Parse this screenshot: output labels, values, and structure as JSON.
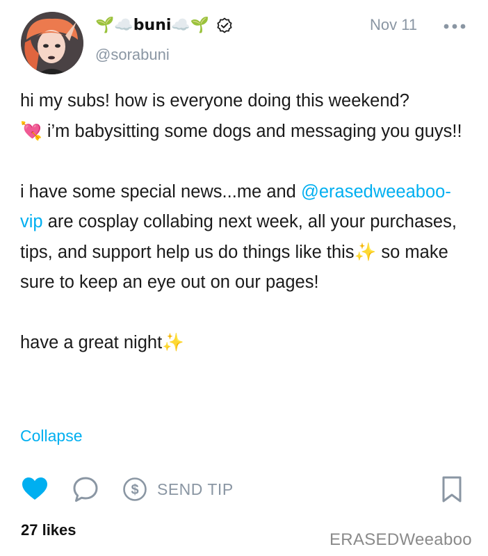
{
  "author": {
    "display_name": "🌱☁️buni☁️🌱",
    "handle": "@sorabuni",
    "avatar": "avatar-photo"
  },
  "post": {
    "date": "Nov 11",
    "line1": "hi my subs! how is everyone doing this weekend?",
    "line2_emoji": "💘",
    "line2": " i’m babysitting some dogs and messaging you guys!!",
    "line3_a": "i have some special news...me and ",
    "mention": "@erasedweeaboo-vip",
    "line3_b": " are cosplay collabing next week, all your purchases, tips, and support help us do things like this",
    "sparkle": "✨",
    "line3_c": " so make sure to keep an eye out on our pages!",
    "line4": "have a great night",
    "collapse_label": "Collapse"
  },
  "actions": {
    "send_tip_label": "SEND TIP",
    "like_color": "#00aff0",
    "icons": [
      "heart-icon",
      "comment-icon",
      "dollar-icon",
      "bookmark-icon",
      "more-icon",
      "verified-icon"
    ]
  },
  "likes": "27 likes",
  "watermark": "ERASEDWeeaboo"
}
